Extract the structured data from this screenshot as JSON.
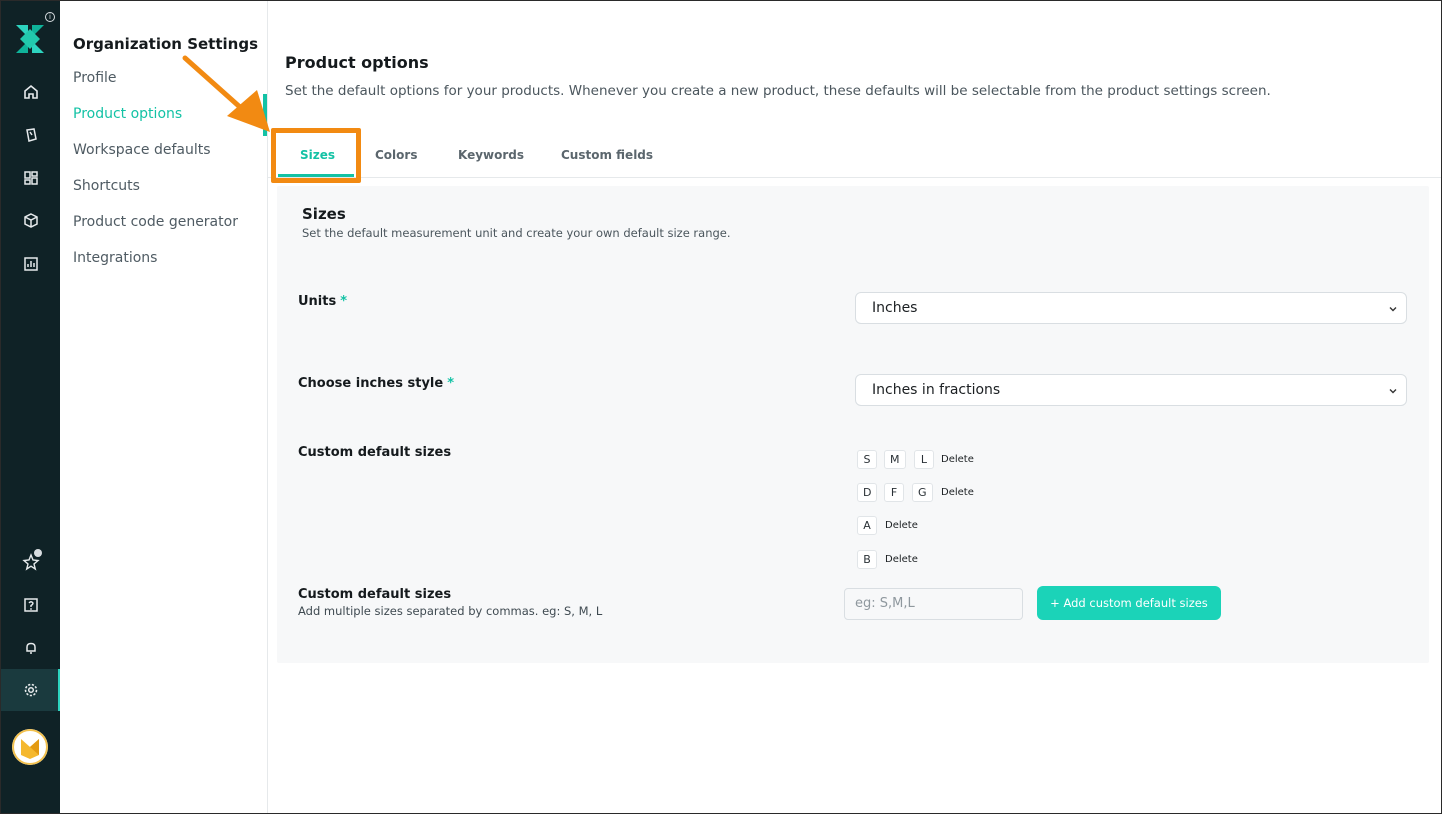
{
  "nav": {
    "title": "Organization Settings",
    "items": [
      {
        "label": "Profile"
      },
      {
        "label": "Product options",
        "active": true
      },
      {
        "label": "Workspace defaults"
      },
      {
        "label": "Shortcuts"
      },
      {
        "label": "Product code generator"
      },
      {
        "label": "Integrations"
      }
    ]
  },
  "rail": {
    "icons": [
      "home-icon",
      "tag-icon",
      "dashboard-icon",
      "box-icon",
      "chart-icon",
      "star-icon",
      "help-icon",
      "bell-icon",
      "gear-icon"
    ],
    "info": "i"
  },
  "page": {
    "title": "Product options",
    "description": "Set the default options for your products. Whenever you create a new product, these defaults will be selectable from the product settings screen."
  },
  "tabs": [
    {
      "label": "Sizes",
      "active": true
    },
    {
      "label": "Colors"
    },
    {
      "label": "Keywords"
    },
    {
      "label": "Custom fields"
    }
  ],
  "sizes": {
    "title": "Sizes",
    "description": "Set the default measurement unit and create your own default size range.",
    "units_label": "Units",
    "units_value": "Inches",
    "inches_style_label": "Choose inches style",
    "inches_style_value": "Inches in fractions",
    "required_mark": "*",
    "custom_sizes_label": "Custom default sizes",
    "size_groups": [
      [
        "S",
        "M",
        "L"
      ],
      [
        "D",
        "F",
        "G"
      ],
      [
        "A"
      ],
      [
        "B"
      ]
    ],
    "delete_label": "Delete",
    "add_label": "Custom default sizes",
    "add_help": "Add multiple sizes separated by commas. eg: S, M, L",
    "input_placeholder": "eg: S,M,L",
    "add_button": "+ Add custom default sizes"
  },
  "colors": {
    "accent": "#13c2a5",
    "rail_bg": "#0f2226",
    "annotation": "#f28a12"
  }
}
